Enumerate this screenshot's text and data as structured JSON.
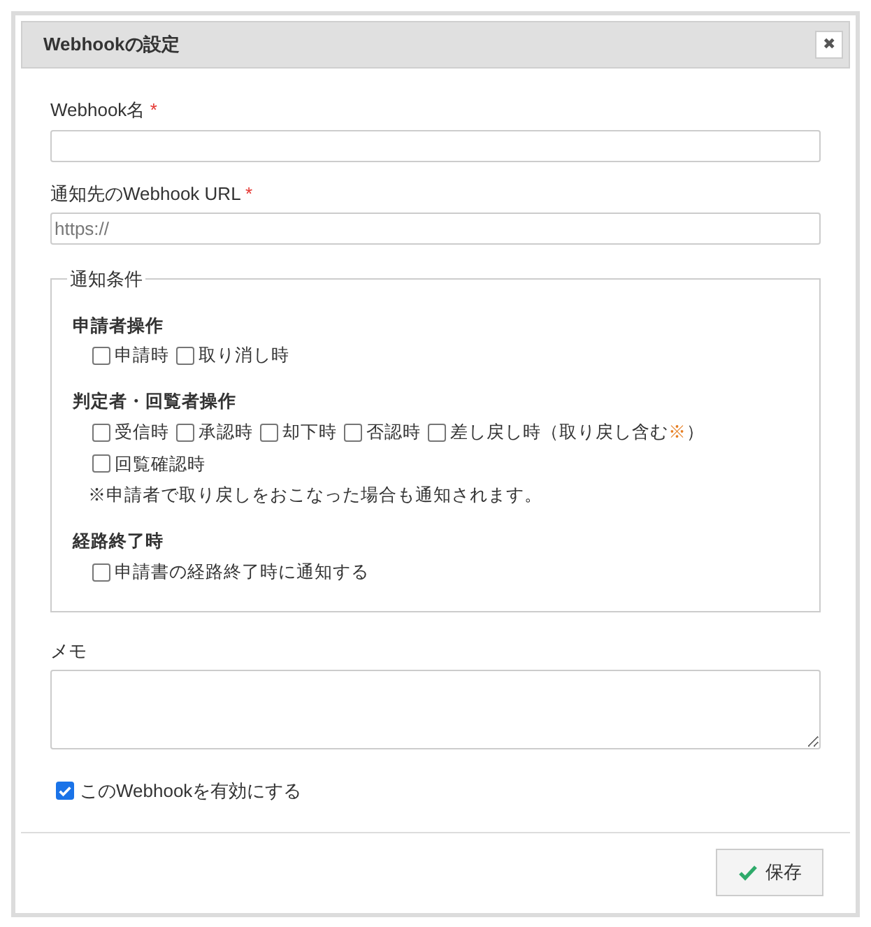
{
  "dialog": {
    "title": "Webhookの設定",
    "close": "✖"
  },
  "fields": [
    {
      "label": "Webhook名",
      "required_mark": "*"
    },
    {
      "label": "通知先のWebhook URL",
      "required_mark": "*",
      "placeholder": "https://"
    }
  ],
  "conditions": {
    "legend": "通知条件",
    "groups": [
      {
        "heading": "申請者操作",
        "rows": [
          [
            {
              "label": "申請時",
              "checked": false
            },
            {
              "label": "取り消し時",
              "checked": false
            }
          ]
        ]
      },
      {
        "heading": "判定者・回覧者操作",
        "rows": [
          [
            {
              "label": "受信時",
              "checked": false
            },
            {
              "label": "承認時",
              "checked": false
            },
            {
              "label": "却下時",
              "checked": false
            },
            {
              "label": "否認時",
              "checked": false
            },
            {
              "label": "差し戻し時（取り戻し含む",
              "note_mark": "※",
              "label_end": "）",
              "checked": false
            }
          ],
          [
            {
              "label": "回覧確認時",
              "checked": false
            }
          ]
        ],
        "note": "※申請者で取り戻しをおこなった場合も通知されます。"
      },
      {
        "heading": "経路終了時",
        "rows": [
          [
            {
              "label": "申請書の経路終了時に通知する",
              "checked": false
            }
          ]
        ]
      }
    ]
  },
  "memo": {
    "label": "メモ"
  },
  "enable": {
    "label": "このWebhookを有効にする",
    "checked": true
  },
  "save_button": "保存"
}
